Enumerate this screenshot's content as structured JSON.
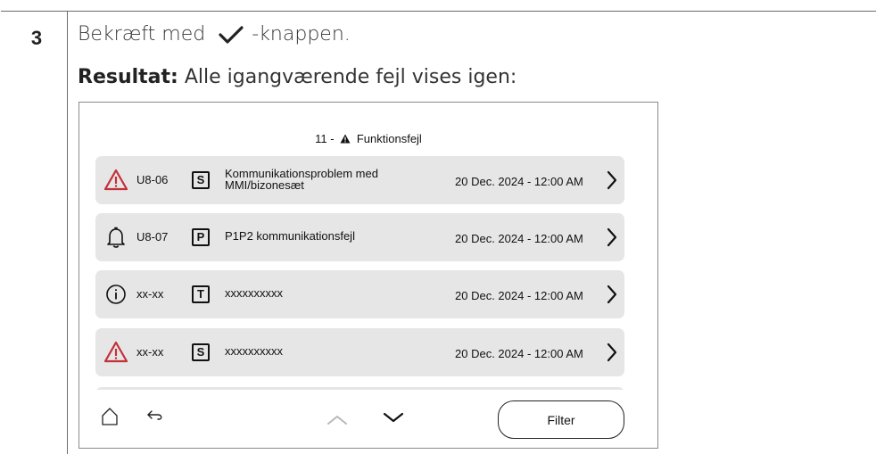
{
  "step": {
    "number": "3",
    "instruction_before": "Bekræft med",
    "instruction_after": "-knappen.",
    "result_label": "Resultat:",
    "result_text": " Alle igangværende fejl vises igen:"
  },
  "screen": {
    "title_prefix": "11 -",
    "title_text": "Funktionsfejl",
    "rows": [
      {
        "icon": "warning-triangle-icon",
        "code": "U8-06",
        "tag": "S",
        "description": "Kommunikationsproblem med MMI/bizonesæt",
        "date": "20 Dec. 2024 - 12:00 AM"
      },
      {
        "icon": "bell-icon",
        "code": "U8-07",
        "tag": "P",
        "description": "P1P2 kommunikationsfejl",
        "date": "20 Dec. 2024 - 12:00 AM"
      },
      {
        "icon": "info-circle-icon",
        "code": "xx-xx",
        "tag": "T",
        "description": "xxxxxxxxxx",
        "date": "20 Dec. 2024 - 12:00 AM"
      },
      {
        "icon": "warning-triangle-icon",
        "code": "xx-xx",
        "tag": "S",
        "description": "xxxxxxxxxx",
        "date": "20 Dec. 2024 - 12:00 AM"
      }
    ],
    "filter_label": "Filter",
    "colors": {
      "warning": "#c4303a",
      "row_bg": "#e6e6e6"
    }
  }
}
